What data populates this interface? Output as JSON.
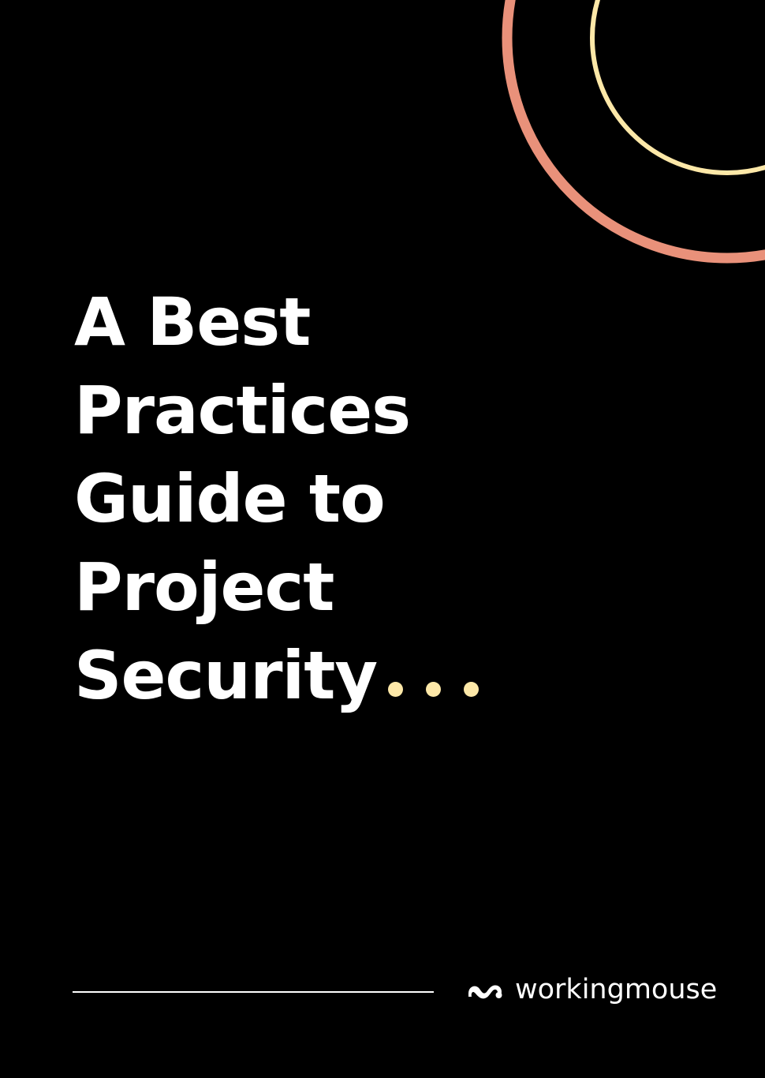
{
  "cover": {
    "title_lines": [
      "A Best",
      "Practices",
      "Guide to",
      "Project",
      "Security"
    ],
    "ellipsis_dot_count": 3
  },
  "brand": {
    "name": "workingmouse",
    "icon": "workingmouse-logo-icon"
  },
  "colors": {
    "background": "#000000",
    "title": "#ffffff",
    "accent_dots": "#fde8a8",
    "outer_ring": "#e9917a",
    "inner_ring": "#fde8a8",
    "rule": "#ffffff"
  }
}
